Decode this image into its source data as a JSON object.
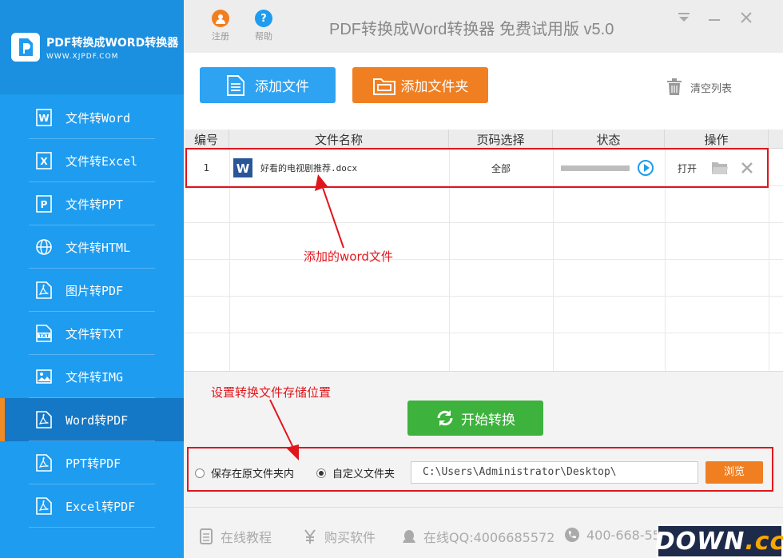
{
  "app": {
    "logo_title": "PDF转换成WORD转换器",
    "logo_url": "WWW.XJPDF.COM",
    "title": "PDF转换成Word转换器 免费试用版 v5.0",
    "register_label": "注册",
    "help_label": "帮助"
  },
  "sidebar": {
    "items": [
      {
        "label": "文件转Word",
        "icon": "word-icon"
      },
      {
        "label": "文件转Excel",
        "icon": "excel-icon"
      },
      {
        "label": "文件转PPT",
        "icon": "ppt-icon"
      },
      {
        "label": "文件转HTML",
        "icon": "globe-icon"
      },
      {
        "label": "图片转PDF",
        "icon": "pdf-icon"
      },
      {
        "label": "文件转TXT",
        "icon": "txt-icon"
      },
      {
        "label": "文件转IMG",
        "icon": "image-icon"
      },
      {
        "label": "Word转PDF",
        "icon": "pdf-icon",
        "active": true
      },
      {
        "label": "PPT转PDF",
        "icon": "pdf-icon"
      },
      {
        "label": "Excel转PDF",
        "icon": "pdf-icon"
      }
    ]
  },
  "toolbar": {
    "add_file": "添加文件",
    "add_folder": "添加文件夹",
    "clear_list": "清空列表"
  },
  "table": {
    "columns": [
      "编号",
      "文件名称",
      "页码选择",
      "状态",
      "操作"
    ],
    "rows": [
      {
        "index": "1",
        "filename": "好看的电视剧推荐.docx",
        "pages": "全部",
        "progress": 0,
        "action_open": "打开"
      }
    ]
  },
  "annotations": {
    "file_note": "添加的word文件",
    "save_note": "设置转换文件存储位置"
  },
  "output": {
    "start_label": "开始转换",
    "option_original": "保存在原文件夹内",
    "option_custom": "自定义文件夹",
    "selected": "custom",
    "path": "C:\\Users\\Administrator\\Desktop\\",
    "browse_label": "浏览"
  },
  "footer": {
    "tutorial": "在线教程",
    "buy": "购买软件",
    "qq": "在线QQ:4006685572",
    "phone": "400-668-55"
  },
  "watermark": {
    "main": "DOWN",
    "suffix": ".cc"
  },
  "colors": {
    "sidebar": "#1e9cf0",
    "accent_orange": "#f07f22",
    "start_green": "#3db23d",
    "annotation_red": "#e0161c"
  }
}
